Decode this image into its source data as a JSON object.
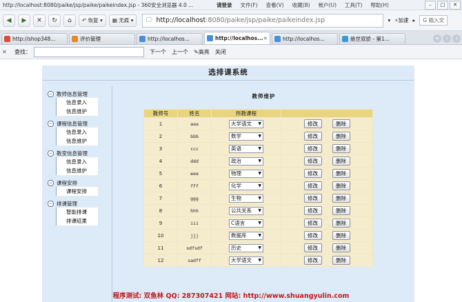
{
  "window": {
    "title": "http://localhost:8080/paike/jsp/paike/paikeindex.jsp - 360安全浏览器 4.0 ...",
    "user_label": "请登录",
    "menu": [
      "文件(F)",
      "查看(V)",
      "收藏(B)",
      "帐户(U)",
      "工具(T)",
      "帮助(H)"
    ]
  },
  "toolbar": {
    "restore_label": "恢复",
    "nohack_label": "无痕",
    "url_host": "http://localhost",
    "url_rest": ":8080/paike/jsp/paike/paikeindex.jsp",
    "speedup_label": "加速",
    "search_placeholder": "输入文"
  },
  "tabs": [
    {
      "label": "http://shop348...",
      "color": "#e0483a",
      "active": false
    },
    {
      "label": "评价管理",
      "color": "#e08a2a",
      "active": false
    },
    {
      "label": "http://localhos...",
      "color": "#4a8fd8",
      "active": false
    },
    {
      "label": "http://localhos...",
      "color": "#4a8fd8",
      "active": true
    },
    {
      "label": "http://localhos...",
      "color": "#4a8fd8",
      "active": false
    },
    {
      "label": "绝世双骄 - 第1...",
      "color": "#3a9ad8",
      "active": false
    }
  ],
  "findbar": {
    "find_label": "查找：",
    "next_label": "下一个",
    "prev_label": "上一个",
    "highlight_label": "高亮",
    "close_label": "关闭"
  },
  "page": {
    "banner": "选排课系统",
    "panel_title": "教师维护",
    "footer": "程序测试: 双鱼林 QQ: 287307421 网站: http://www.shuangyulin.com"
  },
  "sidebar": [
    {
      "label": "教师信息管理",
      "items": [
        "信息录入",
        "信息维护"
      ]
    },
    {
      "label": "课程信息管理",
      "items": [
        "信息录入",
        "信息维护"
      ]
    },
    {
      "label": "教室信息管理",
      "items": [
        "信息录入",
        "信息维护"
      ]
    },
    {
      "label": "课程安排",
      "items": [
        "课程安排"
      ]
    },
    {
      "label": "排课管理",
      "items": [
        "智能排课",
        "排课结果"
      ]
    }
  ],
  "table": {
    "headers": [
      "教师号",
      "姓名",
      "所教课程",
      ""
    ],
    "edit_label": "修改",
    "delete_label": "删除",
    "rows": [
      {
        "id": "1",
        "name": "aaa",
        "course": "大学语文"
      },
      {
        "id": "2",
        "name": "bbb",
        "course": "数学"
      },
      {
        "id": "3",
        "name": "ccc",
        "course": "英语"
      },
      {
        "id": "4",
        "name": "ddd",
        "course": "政治"
      },
      {
        "id": "5",
        "name": "eee",
        "course": "物理"
      },
      {
        "id": "6",
        "name": "fff",
        "course": "化学"
      },
      {
        "id": "7",
        "name": "ggg",
        "course": "生物"
      },
      {
        "id": "8",
        "name": "hhh",
        "course": "公共关系"
      },
      {
        "id": "9",
        "name": "iii",
        "course": "C语言"
      },
      {
        "id": "10",
        "name": "jjj",
        "course": "数据库"
      },
      {
        "id": "11",
        "name": "sdfsdf",
        "course": "历史"
      },
      {
        "id": "12",
        "name": "sadff",
        "course": "大学语文"
      }
    ]
  }
}
